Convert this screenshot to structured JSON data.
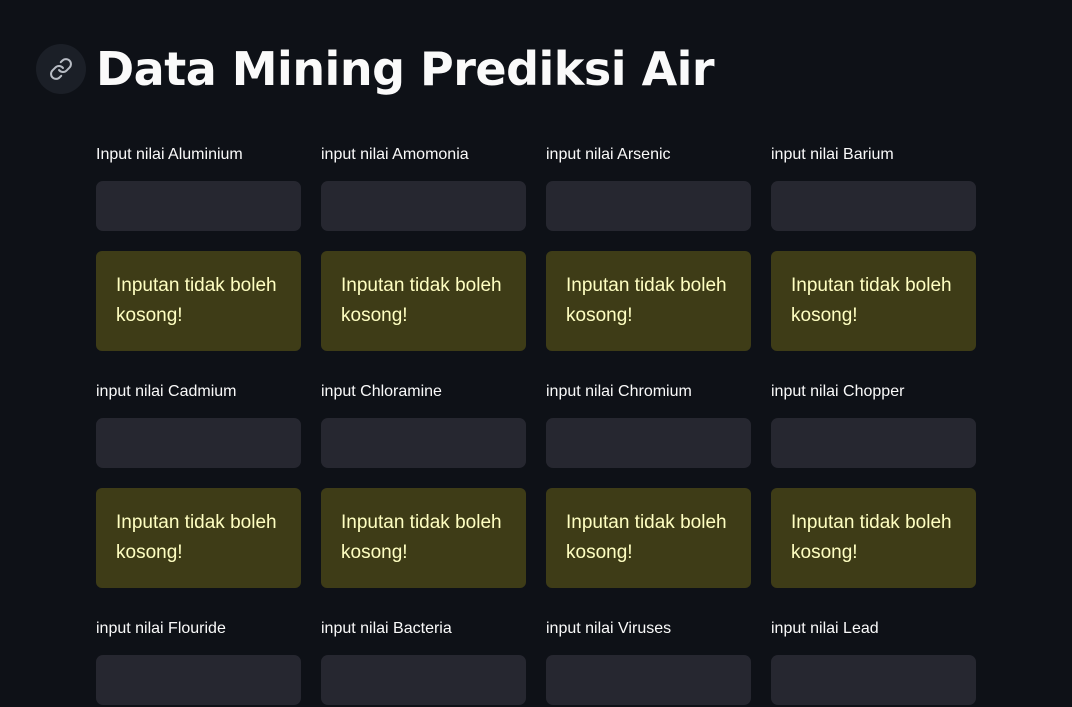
{
  "page": {
    "title": "Data Mining Prediksi Air",
    "anchor_icon": "link-icon"
  },
  "fields": [
    {
      "label": "Input nilai Aluminium",
      "value": "",
      "warning": "Inputan tidak boleh kosong!"
    },
    {
      "label": "input nilai Amomonia",
      "value": "",
      "warning": "Inputan tidak boleh kosong!"
    },
    {
      "label": "input nilai Arsenic",
      "value": "",
      "warning": "Inputan tidak boleh kosong!"
    },
    {
      "label": "input nilai Barium",
      "value": "",
      "warning": "Inputan tidak boleh kosong!"
    },
    {
      "label": "input nilai Cadmium",
      "value": "",
      "warning": "Inputan tidak boleh kosong!"
    },
    {
      "label": "input Chloramine",
      "value": "",
      "warning": "Inputan tidak boleh kosong!"
    },
    {
      "label": "input nilai Chromium",
      "value": "",
      "warning": "Inputan tidak boleh kosong!"
    },
    {
      "label": "input nilai Chopper",
      "value": "",
      "warning": "Inputan tidak boleh kosong!"
    },
    {
      "label": "input nilai Flouride",
      "value": ""
    },
    {
      "label": "input nilai Bacteria",
      "value": ""
    },
    {
      "label": "input nilai Viruses",
      "value": ""
    },
    {
      "label": "input nilai Lead",
      "value": ""
    }
  ],
  "colors": {
    "background": "#0e1117",
    "input_background": "#262730",
    "warning_background": "#3e3c17",
    "warning_text": "#ffffc2"
  }
}
